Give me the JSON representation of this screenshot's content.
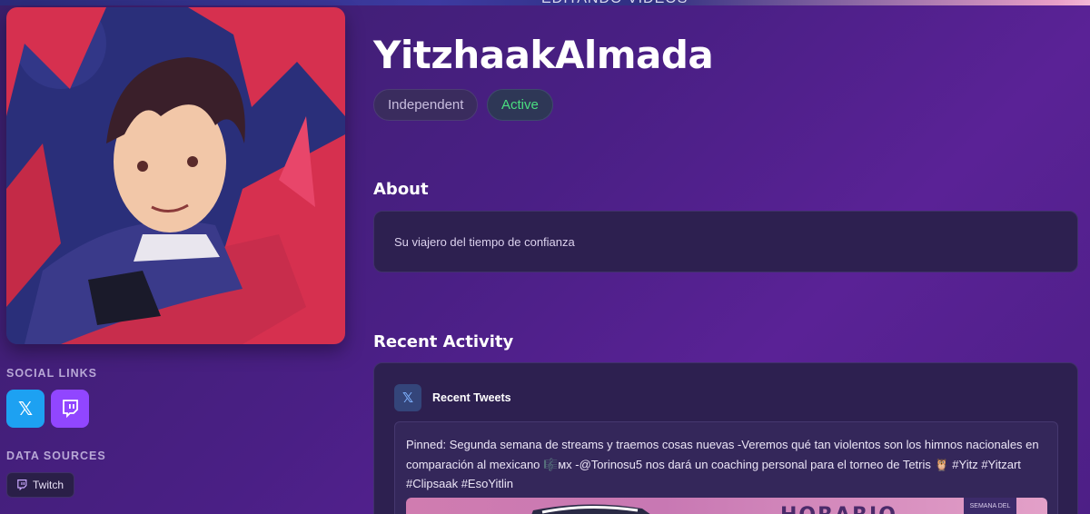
{
  "banner": {
    "text": "EDITANDO VIDEOS"
  },
  "profile": {
    "name": "YitzhaakAlmada",
    "badges": [
      {
        "label": "Independent"
      },
      {
        "label": "Active",
        "color": "#4ade80"
      }
    ]
  },
  "sidebar": {
    "social_label": "SOCIAL LINKS",
    "social_links": [
      {
        "icon": "x-logo-icon",
        "glyph": "𝕏",
        "color": "#1da1f2"
      },
      {
        "icon": "twitch-logo-icon",
        "color": "#9146ff"
      }
    ],
    "sources_label": "DATA SOURCES",
    "sources": [
      {
        "label": "Twitch",
        "icon": "twitch-icon"
      }
    ]
  },
  "about": {
    "heading": "About",
    "text": "Su viajero del tiempo de confianza"
  },
  "activity": {
    "heading": "Recent Activity",
    "tweets_title": "Recent Tweets",
    "tweets_icon": "𝕏",
    "pinned_tweet": "Pinned: Segunda semana de streams y traemos cosas nuevas -Veremos qué tan violentos son los himnos nacionales en comparación al mexicano 🎼ᴍx -@Torinosu5 nos dará un coaching personal para el torneo de Tetris 🦉 #Yitz #Yitzart #Clipsaak #EsoYitlin",
    "image_title": "HORARIO",
    "image_side": "SEMANA DEL"
  }
}
